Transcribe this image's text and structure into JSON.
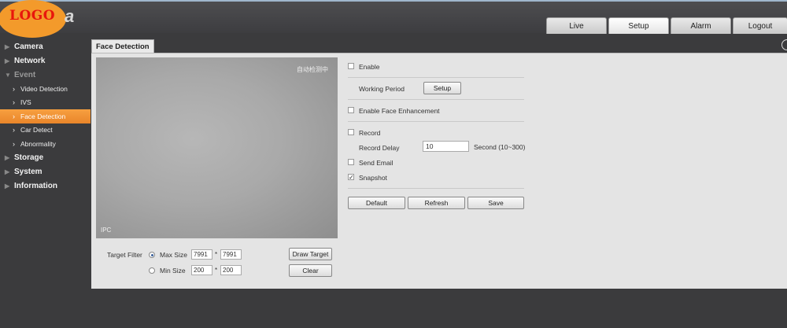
{
  "header": {
    "logo_text": "LOGO",
    "logo_tail": "a",
    "tabs": [
      {
        "label": "Live"
      },
      {
        "label": "Setup"
      },
      {
        "label": "Alarm"
      },
      {
        "label": "Logout"
      }
    ]
  },
  "sidebar": {
    "items": [
      {
        "label": "Camera"
      },
      {
        "label": "Network"
      },
      {
        "label": "Event"
      },
      {
        "label": "Video Detection"
      },
      {
        "label": "IVS"
      },
      {
        "label": "Face Detection"
      },
      {
        "label": "Car Detect"
      },
      {
        "label": "Abnormality"
      },
      {
        "label": "Storage"
      },
      {
        "label": "System"
      },
      {
        "label": "Information"
      }
    ]
  },
  "panel": {
    "title": "Face Detection",
    "video": {
      "osd_top_right": "自动检测中",
      "osd_bottom_left": "IPC"
    },
    "target_filter": {
      "label": "Target Filter",
      "max_label": "Max Size",
      "max_w": "7991",
      "max_h": "7991",
      "min_label": "Min Size",
      "min_w": "200",
      "min_h": "200",
      "separator": "*",
      "draw_button": "Draw Target",
      "clear_button": "Clear"
    },
    "settings": {
      "enable_label": "Enable",
      "working_period_label": "Working Period",
      "working_period_button": "Setup",
      "face_enhancement_label": "Enable Face Enhancement",
      "record_label": "Record",
      "record_delay_label": "Record Delay",
      "record_delay_value": "10",
      "record_delay_unit": "Second (10~300)",
      "send_email_label": "Send Email",
      "snapshot_label": "Snapshot",
      "snapshot_check": "✓"
    },
    "buttons": {
      "default": "Default",
      "refresh": "Refresh",
      "save": "Save"
    }
  },
  "colors": {
    "accent": "#f39a2b",
    "active_menu": "#ee8a2c",
    "background": "#3b3b3d"
  }
}
